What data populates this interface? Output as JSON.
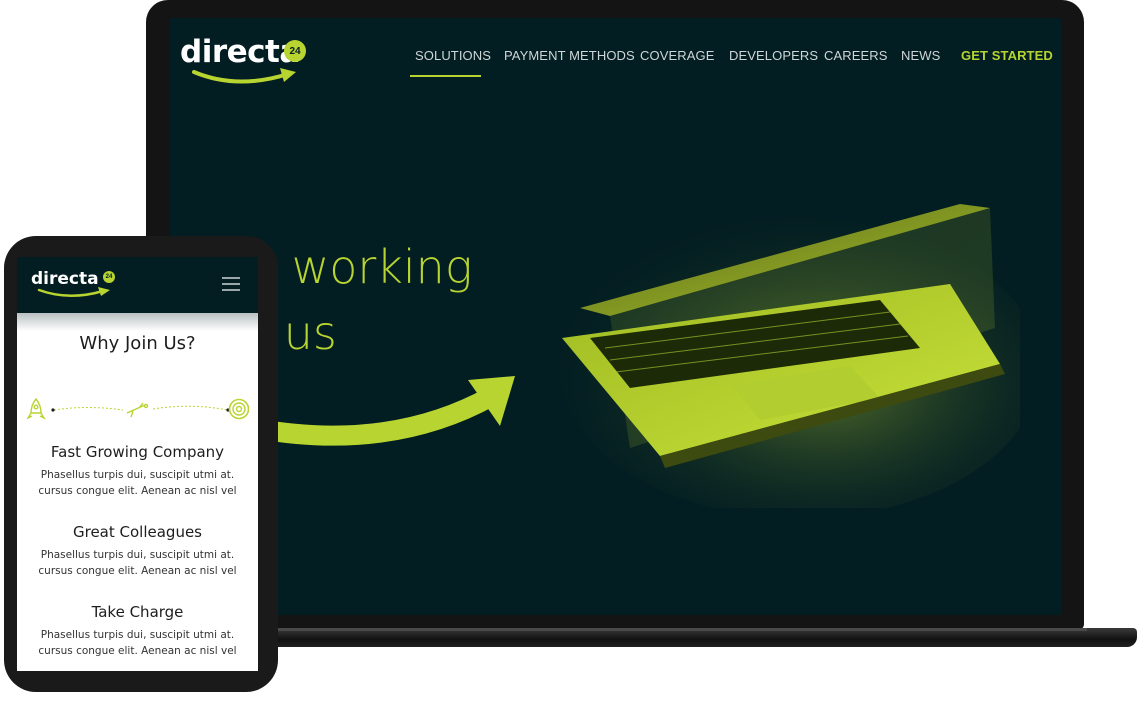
{
  "brand": {
    "logo_text": "directa",
    "logo_badge": "24",
    "accent_color": "#b8d431",
    "background_color": "#031e22"
  },
  "desktop": {
    "nav": {
      "items": [
        "SOLUTIONS",
        "PAYMENT METHODS",
        "COVERAGE",
        "DEVELOPERS",
        "CAREERS",
        "NEWS"
      ],
      "active": "SOLUTIONS",
      "cta": "GET STARTED"
    },
    "hero": {
      "line1": "rt working",
      "line2": "h us"
    }
  },
  "mobile": {
    "menu_icon": "hamburger-icon",
    "section_title": "Why Join Us?",
    "journey_icons": [
      "rocket-icon",
      "plane-icon",
      "target-icon"
    ],
    "features": [
      {
        "title": "Fast Growing Company",
        "line1": "Phasellus turpis dui, suscipit utmi at.",
        "line2": "cursus congue elit. Aenean ac nisl vel"
      },
      {
        "title": "Great Colleagues",
        "line1": "Phasellus turpis dui, suscipit utmi at.",
        "line2": "cursus congue elit. Aenean ac nisl vel"
      },
      {
        "title": "Take Charge",
        "line1": "Phasellus turpis dui, suscipit utmi at.",
        "line2": "cursus congue elit. Aenean ac nisl vel"
      }
    ]
  }
}
